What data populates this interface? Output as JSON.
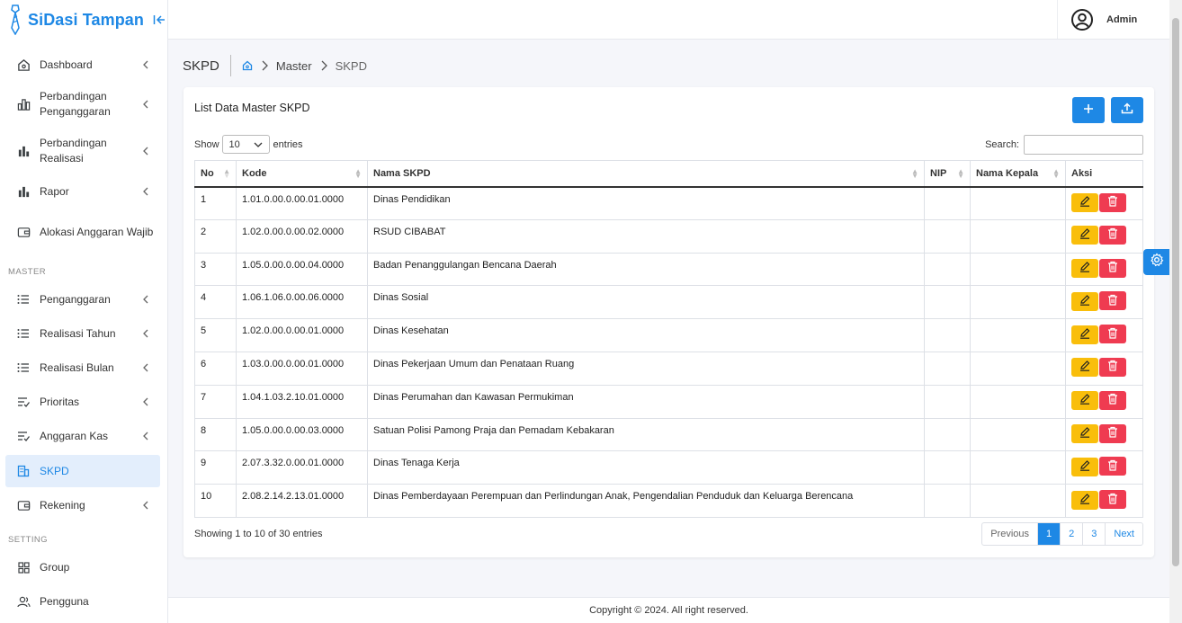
{
  "brand": {
    "title": "SiDasi Tampan"
  },
  "user": {
    "name": "Admin"
  },
  "nav": [
    {
      "label": "Dashboard"
    },
    {
      "label": "Perbandingan Penganggaran"
    },
    {
      "label": "Perbandingan Realisasi"
    },
    {
      "label": "Rapor"
    },
    {
      "label": "Alokasi Anggaran Wajib"
    },
    {
      "label": "Penganggaran"
    },
    {
      "label": "Realisasi Tahun"
    },
    {
      "label": "Realisasi Bulan"
    },
    {
      "label": "Prioritas"
    },
    {
      "label": "Anggaran Kas"
    },
    {
      "label": "SKPD"
    },
    {
      "label": "Rekening"
    },
    {
      "label": "Group"
    },
    {
      "label": "Pengguna"
    }
  ],
  "sections": {
    "master": "MASTER",
    "setting": "SETTING"
  },
  "breadcrumb": {
    "page": "SKPD",
    "master": "Master",
    "current": "SKPD"
  },
  "card": {
    "title": "List Data Master SKPD"
  },
  "controls": {
    "show": "Show",
    "page_size": "10",
    "entries": "entries",
    "search": "Search:"
  },
  "table": {
    "headers": [
      "No",
      "Kode",
      "Nama SKPD",
      "NIP",
      "Nama Kepala",
      "Aksi"
    ],
    "rows": [
      {
        "no": "1",
        "kode": "1.01.0.00.0.00.01.0000",
        "nama": "Dinas Pendidikan",
        "nip": "",
        "kepala": ""
      },
      {
        "no": "2",
        "kode": "1.02.0.00.0.00.02.0000",
        "nama": "RSUD CIBABAT",
        "nip": "",
        "kepala": ""
      },
      {
        "no": "3",
        "kode": "1.05.0.00.0.00.04.0000",
        "nama": "Badan Penanggulangan Bencana Daerah",
        "nip": "",
        "kepala": ""
      },
      {
        "no": "4",
        "kode": "1.06.1.06.0.00.06.0000",
        "nama": "Dinas Sosial",
        "nip": "",
        "kepala": ""
      },
      {
        "no": "5",
        "kode": "1.02.0.00.0.00.01.0000",
        "nama": "Dinas Kesehatan",
        "nip": "",
        "kepala": ""
      },
      {
        "no": "6",
        "kode": "1.03.0.00.0.00.01.0000",
        "nama": "Dinas Pekerjaan Umum dan Penataan Ruang",
        "nip": "",
        "kepala": ""
      },
      {
        "no": "7",
        "kode": "1.04.1.03.2.10.01.0000",
        "nama": "Dinas Perumahan dan Kawasan Permukiman",
        "nip": "",
        "kepala": ""
      },
      {
        "no": "8",
        "kode": "1.05.0.00.0.00.03.0000",
        "nama": "Satuan Polisi Pamong Praja dan Pemadam Kebakaran",
        "nip": "",
        "kepala": ""
      },
      {
        "no": "9",
        "kode": "2.07.3.32.0.00.01.0000",
        "nama": "Dinas Tenaga Kerja",
        "nip": "",
        "kepala": ""
      },
      {
        "no": "10",
        "kode": "2.08.2.14.2.13.01.0000",
        "nama": "Dinas Pemberdayaan Perempuan dan Perlindungan Anak, Pengendalian Penduduk dan Keluarga Berencana",
        "nip": "",
        "kepala": ""
      }
    ]
  },
  "info": "Showing 1 to 10 of 30 entries",
  "pagination": {
    "previous": "Previous",
    "pages": [
      "1",
      "2",
      "3"
    ],
    "next": "Next",
    "current": "1"
  },
  "footer": "Copyright © 2024. All right reserved.",
  "colors": {
    "primary": "#1e88e5",
    "edit": "#f9be0b",
    "delete": "#ef3b51"
  }
}
